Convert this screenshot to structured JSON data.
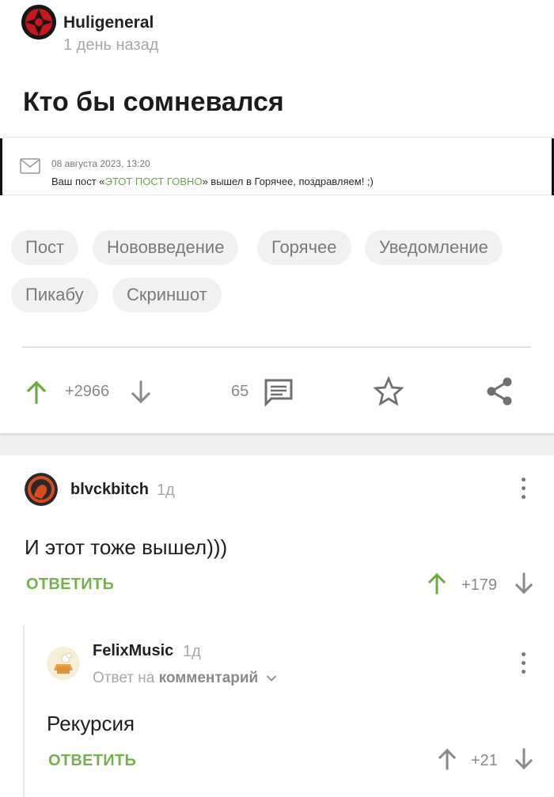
{
  "post": {
    "author": "Huligeneral",
    "time": "1 день назад",
    "title": "Кто бы сомневался",
    "screenshot": {
      "date": "08 августа 2023, 13:20",
      "msg_before": "Ваш пост «",
      "msg_highlight": "ЭТОТ ПОСТ ГОВНО",
      "msg_after": "» вышел в Горячее, поздравляем! ;)"
    },
    "tags": [
      "Пост",
      "Нововведение",
      "Горячее",
      "Уведомление",
      "Пикабу",
      "Скриншот"
    ],
    "rating": "+2966",
    "comments_count": "65"
  },
  "comments": [
    {
      "author": "blvckbitch",
      "time": "1д",
      "text": "И этот тоже вышел)))",
      "reply_label": "ОТВЕТИТЬ",
      "rating": "+179"
    },
    {
      "author": "FelixMusic",
      "time": "1д",
      "reply_to_prefix": "Ответ на",
      "reply_to_target": "комментарий",
      "text": "Рекурсия",
      "reply_label": "ОТВЕТИТЬ",
      "rating": "+21"
    }
  ],
  "colors": {
    "accent_green": "#74b34a",
    "upvote_green": "#6aad3f",
    "muted_gray": "#8a8a8a"
  },
  "icons": [
    "upvote-arrow-icon",
    "downvote-arrow-icon",
    "comment-icon",
    "star-icon",
    "share-icon",
    "mail-icon",
    "more-vertical-icon",
    "chevron-down-icon"
  ]
}
